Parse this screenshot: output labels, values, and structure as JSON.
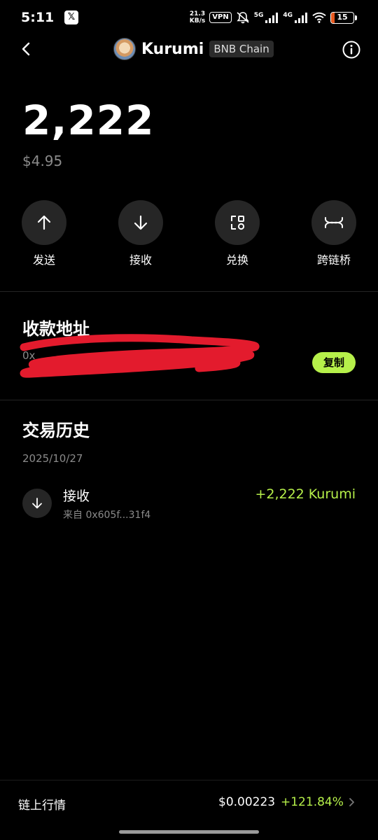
{
  "status_bar": {
    "time": "5:11",
    "x_badge": "𝕏",
    "net_speed_value": "21.3",
    "net_speed_unit": "KB/s",
    "vpn": "VPN",
    "net_5g": "5G",
    "net_4g": "4G",
    "battery": "15",
    "battery_level_percent": 15,
    "battery_color": "#e8581e"
  },
  "header": {
    "token_name": "Kurumi",
    "chain": "BNB Chain"
  },
  "balance": {
    "amount": "2,222",
    "usd": "$4.95"
  },
  "actions": [
    {
      "label": "发送",
      "icon": "arrow-up-icon"
    },
    {
      "label": "接收",
      "icon": "arrow-down-icon"
    },
    {
      "label": "兑换",
      "icon": "swap-icon"
    },
    {
      "label": "跨链桥",
      "icon": "bridge-icon"
    }
  ],
  "receive": {
    "title": "收款地址",
    "address_visible_fragment": "0x",
    "copy_label": "复制"
  },
  "history": {
    "title": "交易历史",
    "groups": [
      {
        "date": "2025/10/27",
        "items": [
          {
            "type": "接收",
            "from": "来自 0x605f...31f4",
            "amount": "+2,222 Kurumi"
          }
        ]
      }
    ]
  },
  "market": {
    "label": "链上行情",
    "price": "$0.00223",
    "change": "+121.84%"
  },
  "colors": {
    "accent_green": "#b6f04a",
    "background": "#000000",
    "muted_text": "#8a8a8a",
    "circle_bg": "#262626",
    "redaction": "#e31b2d"
  }
}
